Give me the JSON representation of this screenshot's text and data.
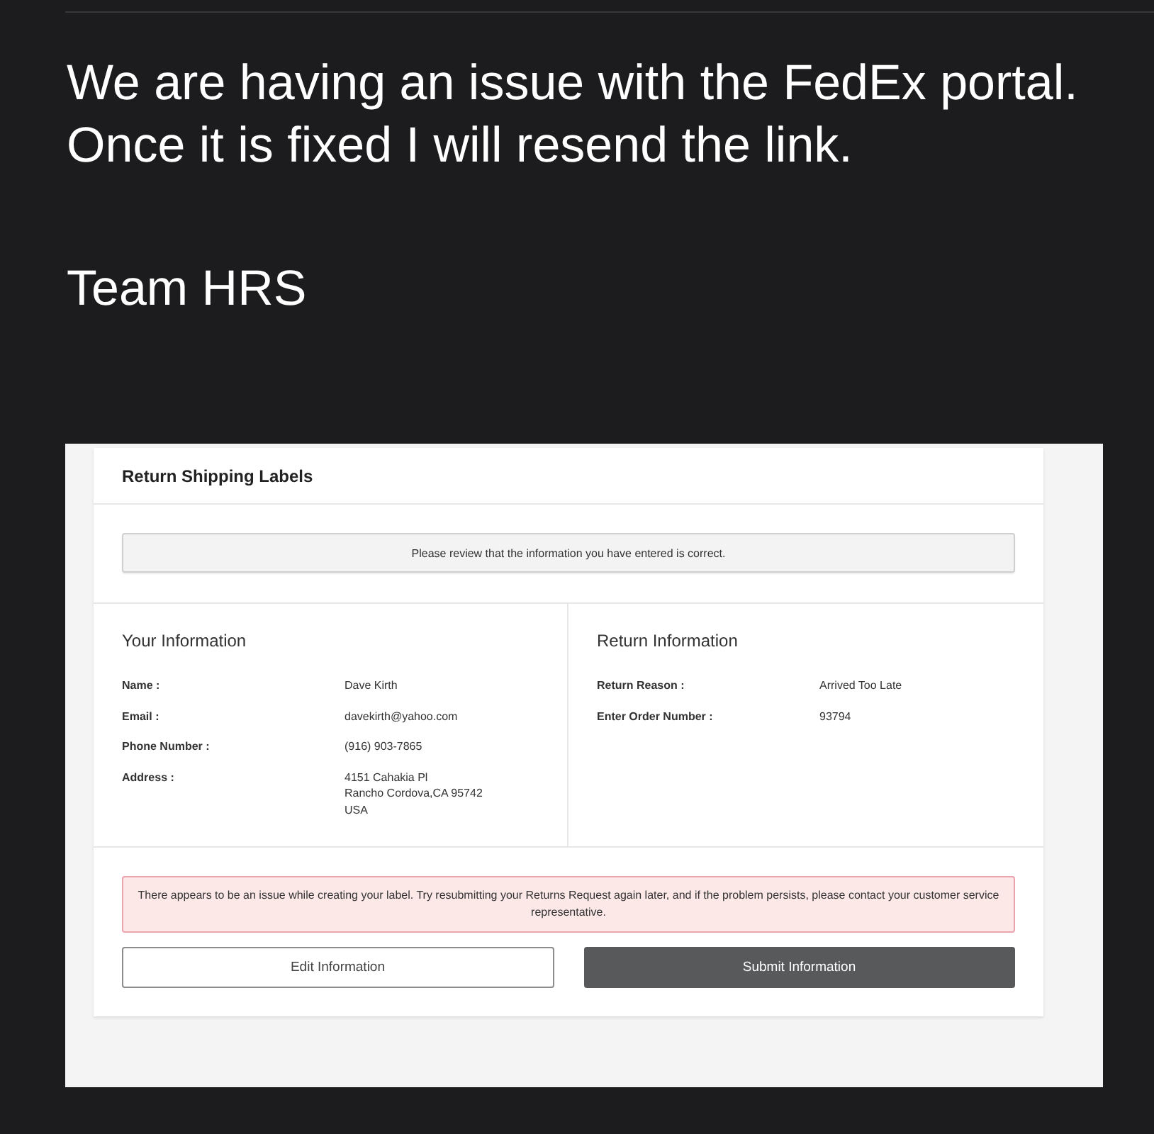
{
  "message": {
    "text": "We are having an issue with the FedEx portal. Once it is fixed I will resend the link.",
    "signature": "Team HRS"
  },
  "attachment": {
    "title": "Return Shipping Labels",
    "notice": "Please review that the information you have entered is correct.",
    "sections": [
      {
        "title": "Your Information",
        "fields": [
          {
            "label": "Name :",
            "value": "Dave Kirth"
          },
          {
            "label": "Email :",
            "value": "davekirth@yahoo.com"
          },
          {
            "label": "Phone Number :",
            "value": "(916) 903-7865"
          },
          {
            "label": "Address :",
            "value": "4151 Cahakia Pl\nRancho Cordova,CA 95742\nUSA"
          }
        ]
      },
      {
        "title": "Return Information",
        "fields": [
          {
            "label": "Return Reason :",
            "value": "Arrived Too Late"
          },
          {
            "label": "Enter Order Number :",
            "value": "93794"
          }
        ]
      }
    ],
    "error": "There appears to be an issue while creating your label. Try resubmitting your Returns Request again later, and if the problem persists, please contact your customer service representative.",
    "buttons": [
      {
        "label": "Edit Information",
        "kind": "secondary"
      },
      {
        "label": "Submit Information",
        "kind": "primary"
      }
    ]
  }
}
